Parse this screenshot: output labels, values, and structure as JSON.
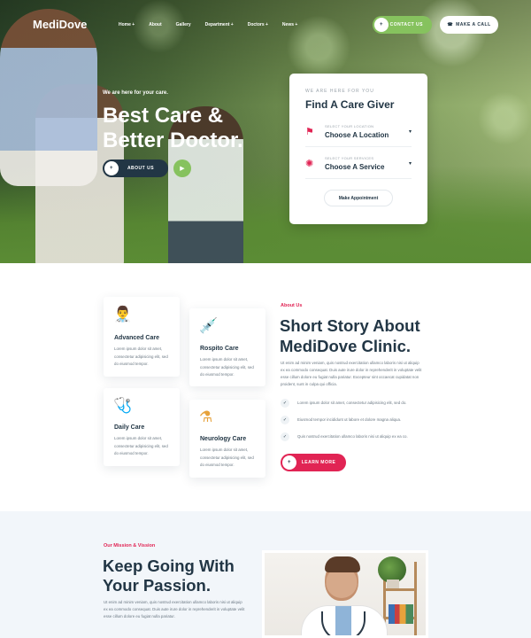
{
  "header": {
    "logo": "MediDove",
    "menu": [
      {
        "label": "Home +"
      },
      {
        "label": "About"
      },
      {
        "label": "Gallery"
      },
      {
        "label": "Department +"
      },
      {
        "label": "Doctors +"
      },
      {
        "label": "News +"
      }
    ],
    "contact_label": "CONTACT US",
    "call_label": "MAKE A CALL"
  },
  "hero": {
    "subtitle": "We are here for your care.",
    "title": "Best Care & Better Doctor.",
    "about_button": "ABOUT US"
  },
  "finder": {
    "subtitle": "WE ARE HERE FOR YOU",
    "title": "Find A Care Giver",
    "location_label": "SELECT YOUR LOCATION",
    "location_value": "Choose A Location",
    "service_label": "SELECT YOUR SERVICES",
    "service_value": "Choose A Service",
    "appointment_button": "Make Appointment"
  },
  "services": [
    {
      "title": "Advanced Care",
      "icon": "doctor-icon",
      "text": "Lorem ipsum dolor sit amet, consectetur adipisicing elit, sed do eiusmod tempor."
    },
    {
      "title": "Rospito Care",
      "icon": "syringe-icon",
      "text": "Lorem ipsum dolor sit amet, consectetur adipisicing elit, sed do eiusmod tempor."
    },
    {
      "title": "Daily Care",
      "icon": "stethoscope-icon",
      "text": "Lorem ipsum dolor sit amet, consectetur adipisicing elit, sed do eiusmod tempor."
    },
    {
      "title": "Neurology Care",
      "icon": "flask-icon",
      "text": "Lorem ipsum dolor sit amet, consectetur adipisicing elit, sed do eiusmod tempor."
    }
  ],
  "about": {
    "label": "About Us",
    "title": "Short Story About MediDove Clinic.",
    "text": "Ut enim ad minim veniam, quis nostrud exercitation ullamco laboris nisi ut aliquip ex ea commodo consequat. Duis aute irure dolor in reprehenderit in voluptate velit esse cillum dolore eu fugiat nulla pariatur. Excepteur sint occaecat cupidatat non proident, sunt in culpa qui officia.",
    "checks": [
      "Lorem ipsum dolor sit amet, consectetur adipisicing elit, sed do.",
      "Eiusmod tempor incididunt ut labore et dolore magna aliqua.",
      "Quis nostrud exercitation ullamco laboris nisi ut aliquip ex ea co."
    ],
    "learn_button": "LEARN MORE"
  },
  "mission": {
    "label": "Our Mission & Vission",
    "title": "Keep Going With Your Passion.",
    "text": "Ut enim ad minim veniam, quis nostrud exercitation ullamco laboris nisi ut aliquip ex ea commodo consequat. Duis aute irure dolor in reprehenderit in voluptate velit esse cillum dolore eu fugiat nulla pariatur."
  },
  "colors": {
    "primary_green": "#86c25e",
    "accent_red": "#e12454",
    "dark_navy": "#223645",
    "mission_bg": "#f2f6fa"
  }
}
